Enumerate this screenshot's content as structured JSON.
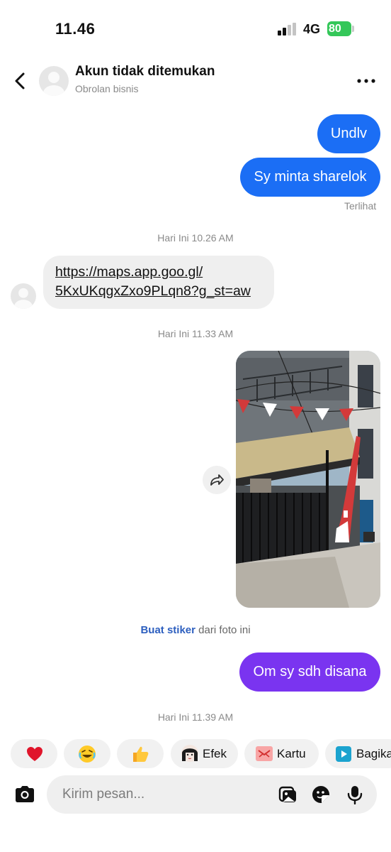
{
  "status_bar": {
    "time": "11.46",
    "network": "4G",
    "battery": "80"
  },
  "header": {
    "title": "Akun tidak ditemukan",
    "subtitle": "Obrolan bisnis"
  },
  "messages": [
    {
      "type": "outgoing",
      "text": "Undlv"
    },
    {
      "type": "outgoing",
      "text": "Sy minta sharelok"
    },
    {
      "type": "status",
      "text": "Terlihat"
    },
    {
      "type": "timestamp",
      "text": "Hari Ini 10.26 AM"
    },
    {
      "type": "incoming",
      "line1": "https://maps.app.goo.gl/",
      "line2": "5KxUKqgxZxo9PLqn8?g_st=aw"
    },
    {
      "type": "timestamp",
      "text": "Hari Ini 11.33 AM"
    },
    {
      "type": "outgoing-photo",
      "description": ""
    },
    {
      "type": "sticker-prompt",
      "link": "Buat stiker",
      "rest": " dari foto ini"
    },
    {
      "type": "outgoing",
      "text": "Om sy sdh disana"
    },
    {
      "type": "timestamp",
      "text": "Hari Ini 11.39 AM"
    }
  ],
  "quick_actions": [
    {
      "icon": "heart-icon",
      "glyph": "❤️"
    },
    {
      "icon": "laughing-icon",
      "glyph": "😂"
    },
    {
      "icon": "thumbs-up-icon",
      "glyph": "👍"
    },
    {
      "icon": "effects-avatar-icon",
      "label": "Efek"
    },
    {
      "icon": "card-icon",
      "label": "Kartu"
    },
    {
      "icon": "share-play-icon",
      "label": "Bagika"
    }
  ],
  "composer": {
    "placeholder": "Kirim pesan..."
  },
  "colors": {
    "outgoing_blue": "#1b6ef5",
    "outgoing_purple": "#7a34f0",
    "incoming_gray": "#efefef",
    "battery_green": "#34c759",
    "link_blue": "#2d5fbf"
  }
}
